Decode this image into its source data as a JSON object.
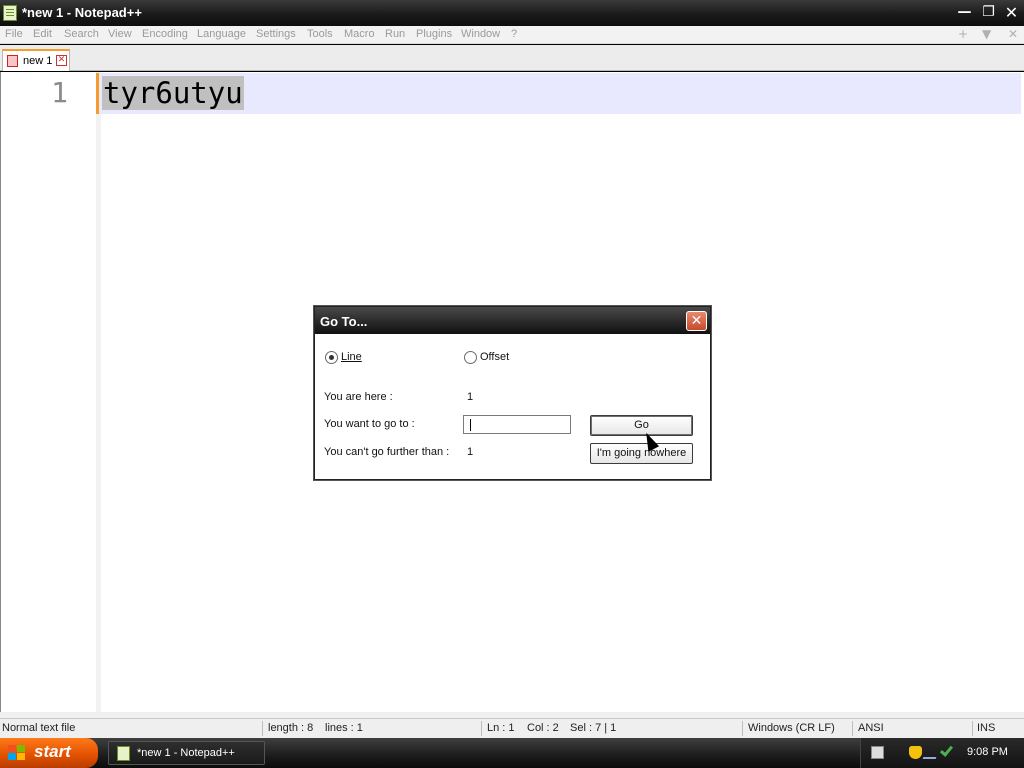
{
  "window": {
    "title": "*new 1 - Notepad++"
  },
  "menu": [
    "File",
    "Edit",
    "Search",
    "View",
    "Encoding",
    "Language",
    "Settings",
    "Tools",
    "Macro",
    "Run",
    "Plugins",
    "Window",
    "?"
  ],
  "menu_right": {
    "add": "+",
    "dropdown": "▼",
    "close": "✕"
  },
  "tab": {
    "label": "new 1"
  },
  "editor": {
    "line_number": "1",
    "text": "tyr6utyu"
  },
  "status": {
    "file_type": "Normal text file",
    "length": "length : 8",
    "lines": "lines : 1",
    "ln": "Ln : 1",
    "col": "Col : 2",
    "sel": "Sel : 7 | 1",
    "eol": "Windows (CR LF)",
    "encoding": "ANSI",
    "mode": "INS"
  },
  "dialog": {
    "title": "Go To...",
    "radio_line": "Line",
    "radio_offset": "Offset",
    "selected": "line",
    "here_label": "You are here :",
    "here_value": "1",
    "goto_label": "You want to go to :",
    "goto_value": "",
    "further_label": "You can't go further than :",
    "further_value": "1",
    "go_button": "Go",
    "nowhere_button": "I'm going nowhere"
  },
  "taskbar": {
    "start": "start",
    "task_label": "*new 1 - Notepad++",
    "clock": "9:08 PM"
  }
}
